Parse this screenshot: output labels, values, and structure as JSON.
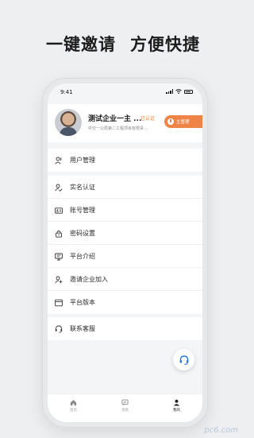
{
  "headline": {
    "left": "一键邀请",
    "right": "方便快捷"
  },
  "status_bar": {
    "time": "9:41"
  },
  "profile": {
    "name": "测试企业一主 ...",
    "verified_label": "已认证",
    "company": "中交一公局第二工程项目有限责 ...",
    "admin_label": "主管理"
  },
  "menu_group_1": [
    {
      "label": "用户管理",
      "icon": "users-icon"
    }
  ],
  "menu_group_2": [
    {
      "label": "实名认证",
      "icon": "user-check-icon"
    },
    {
      "label": "账号管理",
      "icon": "id-card-icon"
    },
    {
      "label": "密码设置",
      "icon": "lock-icon"
    },
    {
      "label": "平台介绍",
      "icon": "monitor-icon"
    },
    {
      "label": "邀请企业加入",
      "icon": "user-add-icon"
    },
    {
      "label": "平台版本",
      "icon": "window-icon"
    }
  ],
  "menu_group_3": [
    {
      "label": "联系客服",
      "icon": "headset-icon"
    }
  ],
  "tabbar": {
    "tabs": [
      {
        "label": "首页",
        "icon": "home-icon"
      },
      {
        "label": "消息",
        "icon": "message-icon"
      },
      {
        "label": "我的",
        "icon": "profile-icon",
        "active": true
      }
    ]
  },
  "watermark": "pc6.com",
  "colors": {
    "accent": "#f08447",
    "verified": "#f0843e",
    "fab_icon": "#2a7bd9"
  }
}
